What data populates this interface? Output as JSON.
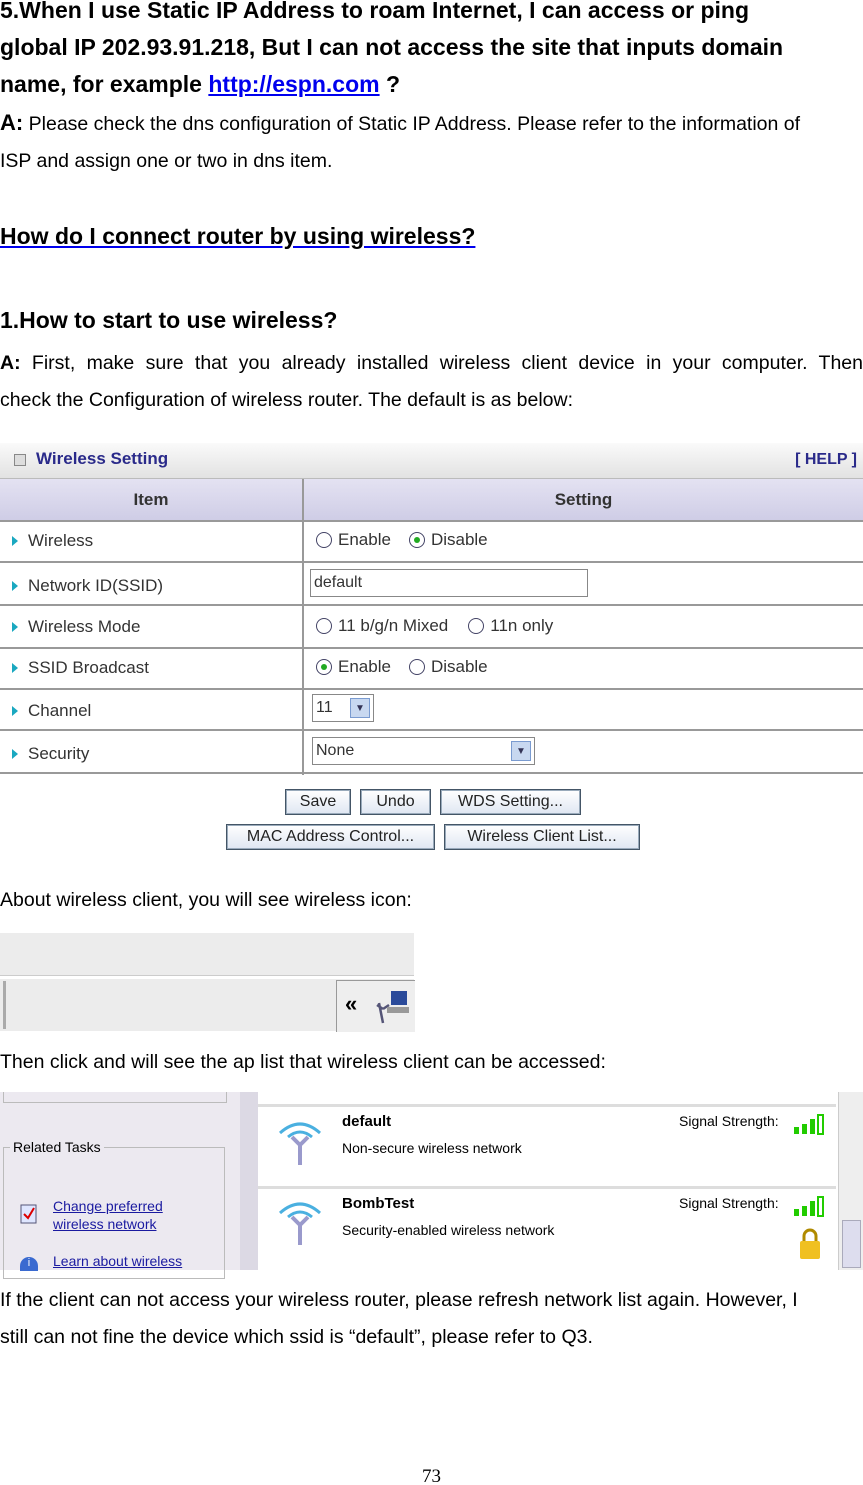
{
  "q5": {
    "title_line1": "5.When I use Static IP Address to roam Internet, I can access or ping",
    "title_line2": "global IP 202.93.91.218, But I can not access the site that inputs domain",
    "title_line3_pre": "name, for example ",
    "title_link": "http://espn.com",
    "title_line3_post": " ?",
    "answer_prefix": "A:",
    "answer_line1": " Please check the dns configuration of Static IP Address. Please refer to the information of",
    "answer_line2": "ISP and assign one or two in dns item."
  },
  "section_heading": "How do I connect router by using wireless?",
  "q1": {
    "title": "1.How to start to use wireless?",
    "answer_prefix": "A:",
    "answer_line1": " First, make sure that you already installed wireless client device in your computer. Then",
    "answer_line2": "check the Configuration of wireless router. The default is as below:"
  },
  "wireless_setting": {
    "title": "Wireless Setting",
    "help": "[ HELP ]",
    "col_item": "Item",
    "col_setting": "Setting",
    "rows": [
      {
        "label": "Wireless",
        "opt1": "Enable",
        "opt2": "Disable",
        "selected": "Disable"
      },
      {
        "label": "Network ID(SSID)",
        "value": "default"
      },
      {
        "label": "Wireless Mode",
        "opt1": "11 b/g/n Mixed",
        "opt2": "11n only",
        "selected": ""
      },
      {
        "label": "SSID Broadcast",
        "opt1": "Enable",
        "opt2": "Disable",
        "selected": "Enable"
      },
      {
        "label": "Channel",
        "value": "11"
      },
      {
        "label": "Security",
        "value": "None"
      }
    ],
    "buttons": {
      "save": "Save",
      "undo": "Undo",
      "wds": "WDS Setting...",
      "mac": "MAC Address Control...",
      "client_list": "Wireless Client List..."
    }
  },
  "text_about": "About wireless client, you will see wireless icon:",
  "tray": {
    "chevron": "«"
  },
  "text_then": "Then click and will see the ap list that wireless client can be accessed:",
  "ap_list": {
    "related_tasks": "Related Tasks",
    "task1_line1": "Change preferred",
    "task1_line2": "wireless network",
    "task2": "Learn about wireless",
    "networks": [
      {
        "ssid": "default",
        "desc": "Non-secure wireless network",
        "signal_label": "Signal Strength:",
        "signal_bars": 4,
        "secured": false
      },
      {
        "ssid": "BombTest",
        "desc": "Security-enabled wireless network",
        "signal_label": "Signal Strength:",
        "signal_bars": 4,
        "secured": true
      }
    ]
  },
  "final_line1": "If the client can not access your wireless router, please refresh network list again. However, I",
  "final_line2": "still can not fine the device which ssid is “default”, please refer to Q3.",
  "page_number": "73",
  "colors": {
    "link": "#0000ee",
    "ws_title": "#2a2a8a",
    "header_bg": "#d8d6ec",
    "signal": "#22cc00"
  }
}
